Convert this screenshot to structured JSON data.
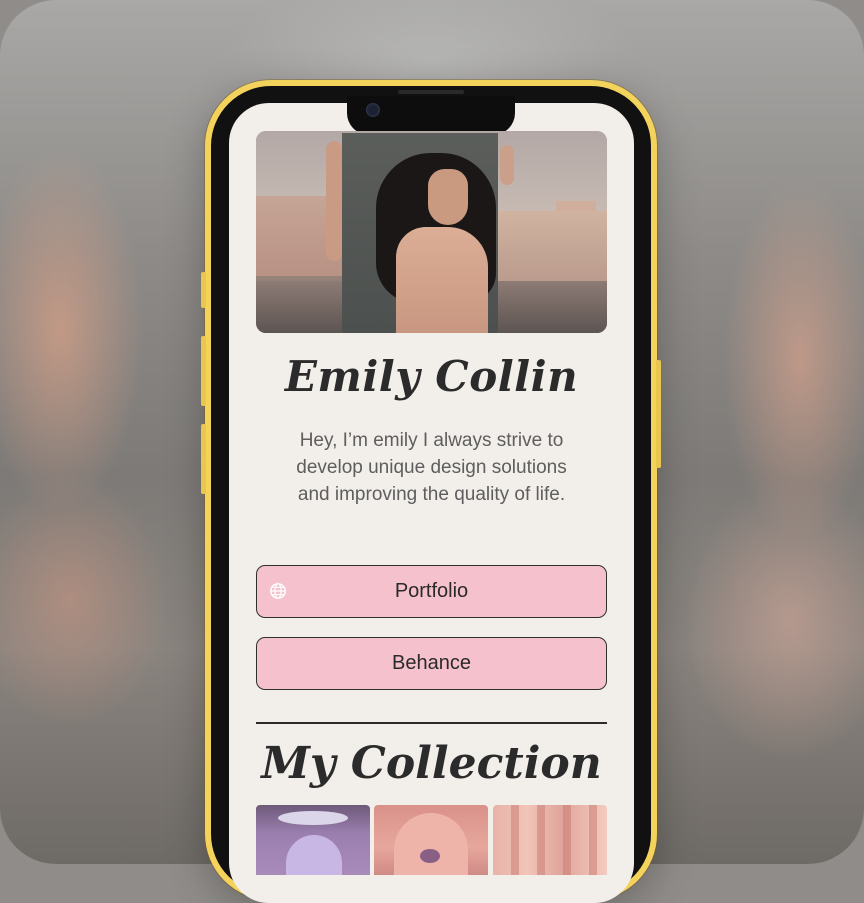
{
  "profile": {
    "name": "Emily Collin",
    "bio": "Hey, I’m emily I always strive to develop unique design solutions and improving the quality of life."
  },
  "links": [
    {
      "label": "Portfolio",
      "icon": "globe-icon"
    },
    {
      "label": "Behance"
    }
  ],
  "collection": {
    "title": "My Collection"
  },
  "colors": {
    "frame": "#f4d35c",
    "screen_bg": "#f2eeea",
    "button_bg": "#f5c1cd",
    "text": "#2b2b2b"
  }
}
